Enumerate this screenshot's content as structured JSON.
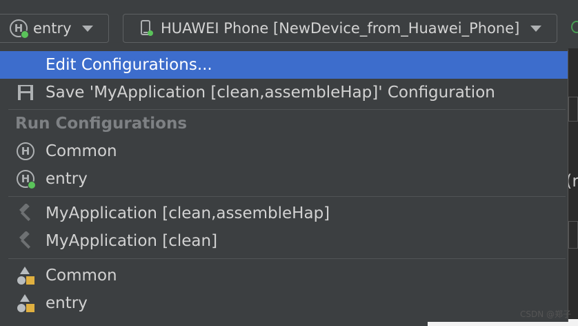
{
  "toolbar": {
    "config_name": "entry",
    "device_name": "HUAWEI Phone [NewDevice_from_Huawei_Phone]"
  },
  "menu": {
    "edit_configurations": "Edit Configurations...",
    "save_configuration": "Save 'MyApplication [clean,assembleHap]' Configuration",
    "run_configurations_header": "Run Configurations",
    "run_configs": [
      "Common",
      "entry"
    ],
    "hvigor_tasks": [
      "MyApplication [clean,assembleHap]",
      "MyApplication [clean]"
    ],
    "modules": [
      "Common",
      "entry"
    ]
  },
  "background": {
    "partial_char": "(r"
  },
  "watermark": "CSDN @郑子",
  "colors": {
    "selection": "#3d6dcc",
    "background": "#3c3f41",
    "run_dot": "#5ac35a",
    "module_triangle": "#b8bcbf",
    "module_square": "#e0b040"
  },
  "icons": {
    "config": "harmony-h-icon",
    "save": "floppy-disk-icon",
    "task": "hammer-icon",
    "module": "module-shapes-icon",
    "device": "phone-device-icon"
  }
}
